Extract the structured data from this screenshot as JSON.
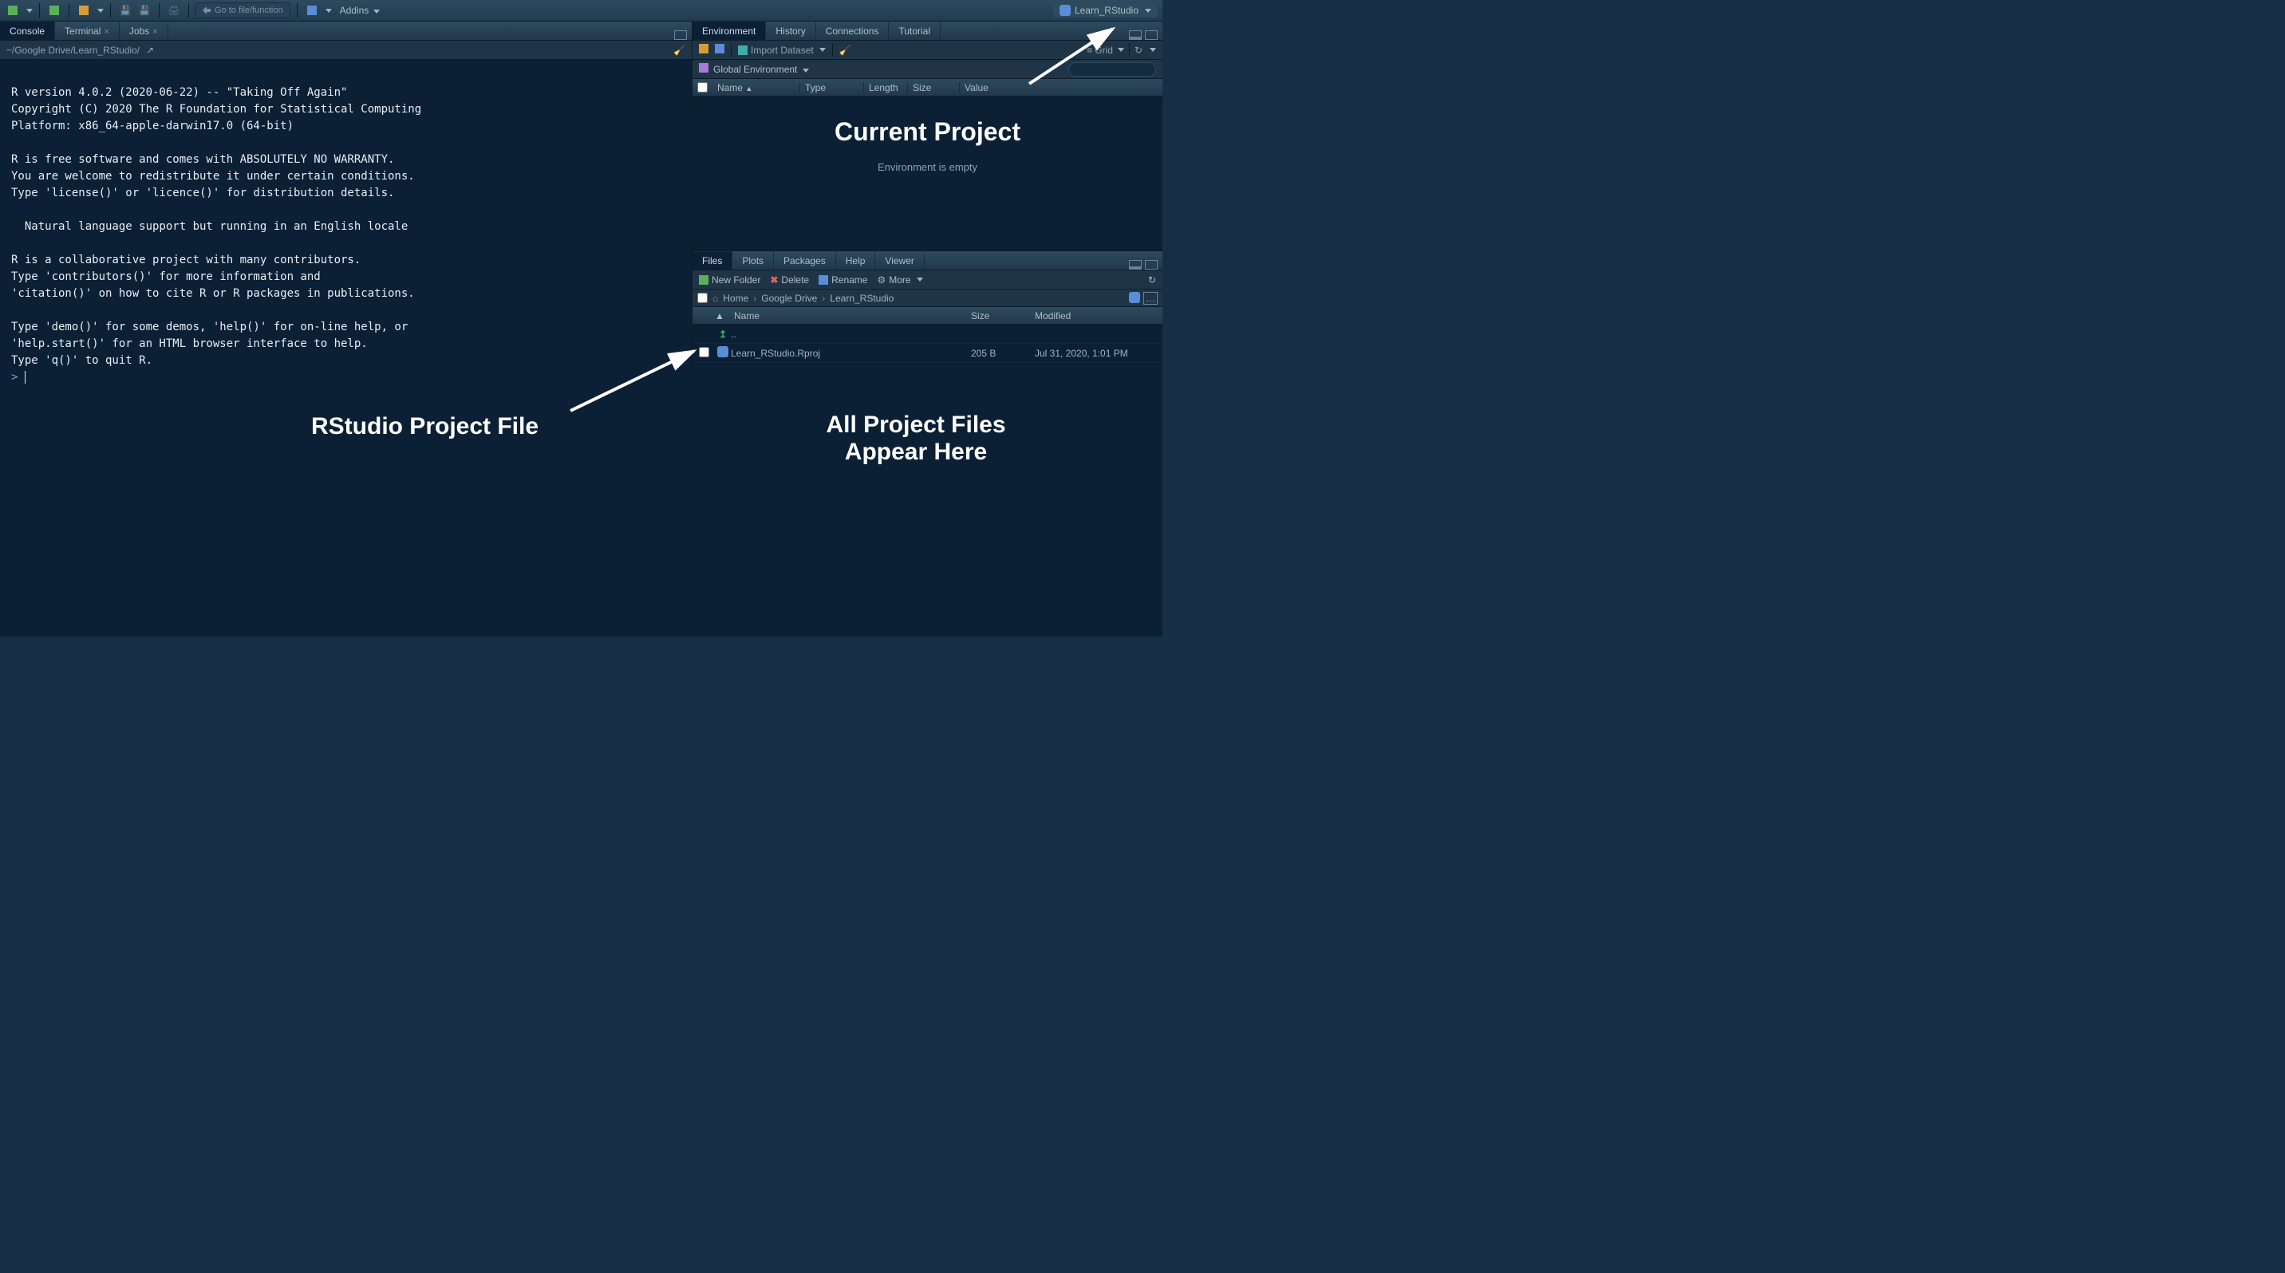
{
  "topbar": {
    "goto_placeholder": "Go to file/function",
    "addins_label": "Addins",
    "project_name": "Learn_RStudio"
  },
  "left": {
    "tabs": [
      "Console",
      "Terminal",
      "Jobs"
    ],
    "path": "~/Google Drive/Learn_RStudio/",
    "console_text": "\nR version 4.0.2 (2020-06-22) -- \"Taking Off Again\"\nCopyright (C) 2020 The R Foundation for Statistical Computing\nPlatform: x86_64-apple-darwin17.0 (64-bit)\n\nR is free software and comes with ABSOLUTELY NO WARRANTY.\nYou are welcome to redistribute it under certain conditions.\nType 'license()' or 'licence()' for distribution details.\n\n  Natural language support but running in an English locale\n\nR is a collaborative project with many contributors.\nType 'contributors()' for more information and\n'citation()' on how to cite R or R packages in publications.\n\nType 'demo()' for some demos, 'help()' for on-line help, or\n'help.start()' for an HTML browser interface to help.\nType 'q()' to quit R.\n",
    "prompt": "> "
  },
  "env": {
    "tabs": [
      "Environment",
      "History",
      "Connections",
      "Tutorial"
    ],
    "import_label": "Import Dataset",
    "view_label": "Grid",
    "scope_label": "Global Environment",
    "headers": {
      "name": "Name",
      "type": "Type",
      "length": "Length",
      "size": "Size",
      "value": "Value"
    },
    "empty_text": "Environment is empty"
  },
  "files": {
    "tabs": [
      "Files",
      "Plots",
      "Packages",
      "Help",
      "Viewer"
    ],
    "toolbar": {
      "new_folder": "New Folder",
      "delete": "Delete",
      "rename": "Rename",
      "more": "More"
    },
    "breadcrumb": [
      "Home",
      "Google Drive",
      "Learn_RStudio"
    ],
    "headers": {
      "name": "Name",
      "size": "Size",
      "modified": "Modified"
    },
    "up_dir": "..",
    "rows": [
      {
        "name": "Learn_RStudio.Rproj",
        "size": "205 B",
        "modified": "Jul 31, 2020, 1:01 PM"
      }
    ]
  },
  "annotations": {
    "current_project": "Current Project",
    "project_file": "RStudio Project File",
    "files_here_l1": "All Project Files",
    "files_here_l2": "Appear Here"
  }
}
